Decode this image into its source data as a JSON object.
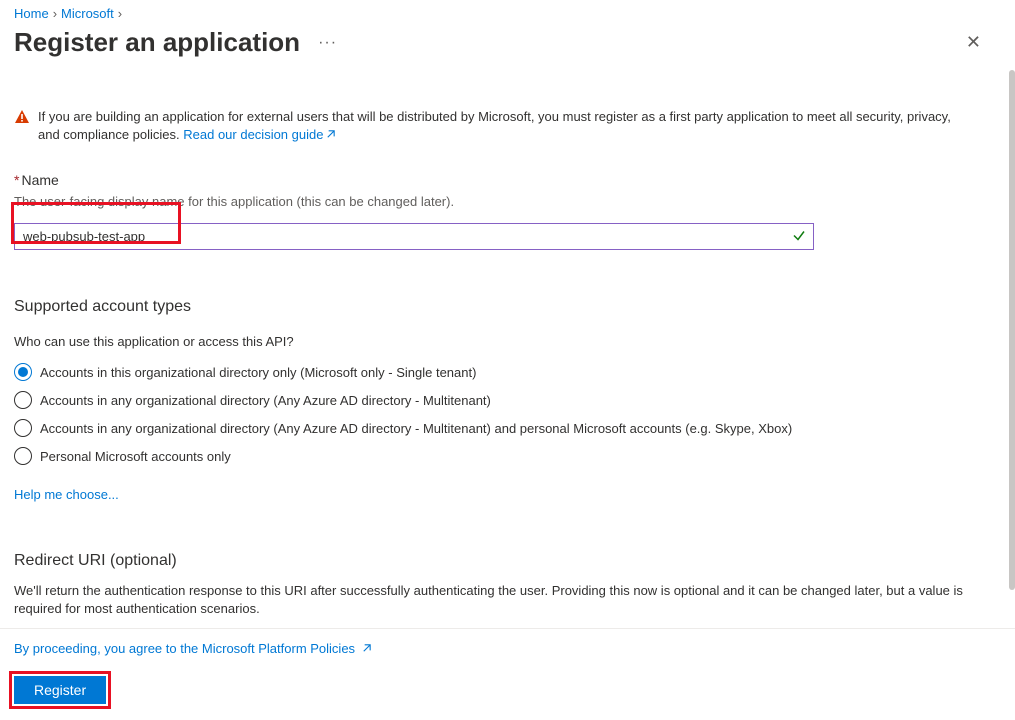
{
  "breadcrumb": {
    "items": [
      "Home",
      "Microsoft"
    ]
  },
  "page": {
    "title": "Register an application"
  },
  "warning": {
    "text_before": "If you are building an application for external users that will be distributed by Microsoft, you must register as a first party application to meet all security, privacy, and compliance policies. ",
    "link_text": "Read our decision guide"
  },
  "name_field": {
    "label": "Name",
    "description": "The user-facing display name for this application (this can be changed later).",
    "value": "web-pubsub-test-app"
  },
  "account_types": {
    "heading": "Supported account types",
    "subtext": "Who can use this application or access this API?",
    "options": [
      "Accounts in this organizational directory only (Microsoft only - Single tenant)",
      "Accounts in any organizational directory (Any Azure AD directory - Multitenant)",
      "Accounts in any organizational directory (Any Azure AD directory - Multitenant) and personal Microsoft accounts (e.g. Skype, Xbox)",
      "Personal Microsoft accounts only"
    ],
    "help_link": "Help me choose..."
  },
  "redirect": {
    "heading": "Redirect URI (optional)",
    "description": "We'll return the authentication response to this URI after successfully authenticating the user. Providing this now is optional and it can be changed later, but a value is required for most authentication scenarios."
  },
  "footer": {
    "policy_text": "By proceeding, you agree to the Microsoft Platform Policies",
    "register_label": "Register"
  }
}
